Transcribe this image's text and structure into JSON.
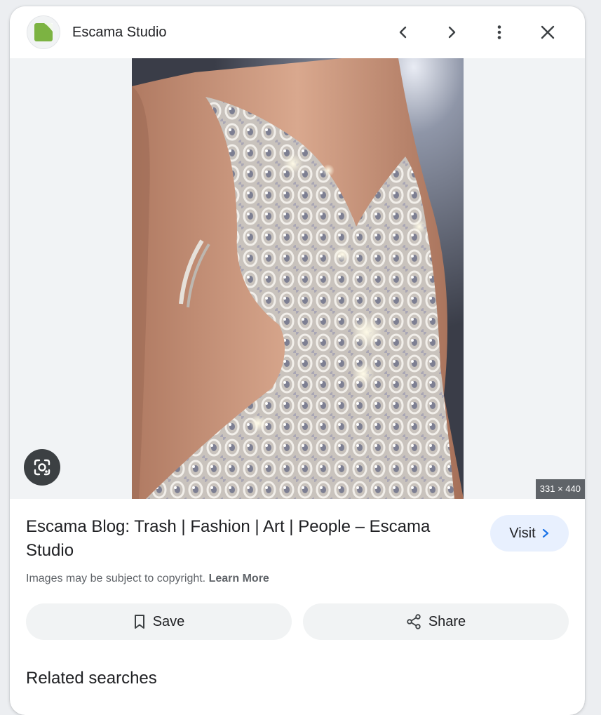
{
  "header": {
    "site_name": "Escama Studio",
    "favicon_icon": "escama-green-square-icon",
    "prev_icon": "chevron-left-icon",
    "next_icon": "chevron-right-icon",
    "more_icon": "more-vert-icon",
    "close_icon": "close-icon"
  },
  "image": {
    "dimensions": "331 × 440",
    "lens_icon": "google-lens-icon"
  },
  "info": {
    "title": "Escama Blog: Trash | Fashion | Art | People – Escama Studio",
    "visit_label": "Visit",
    "copyright_text": "Images may be subject to copyright.",
    "learn_more": "Learn More"
  },
  "actions": {
    "save_label": "Save",
    "share_label": "Share"
  },
  "related": {
    "heading": "Related searches"
  },
  "colors": {
    "visit_bg": "#e8f0fe",
    "favicon_green": "#7cb342",
    "badge_bg": "#5f6368"
  }
}
